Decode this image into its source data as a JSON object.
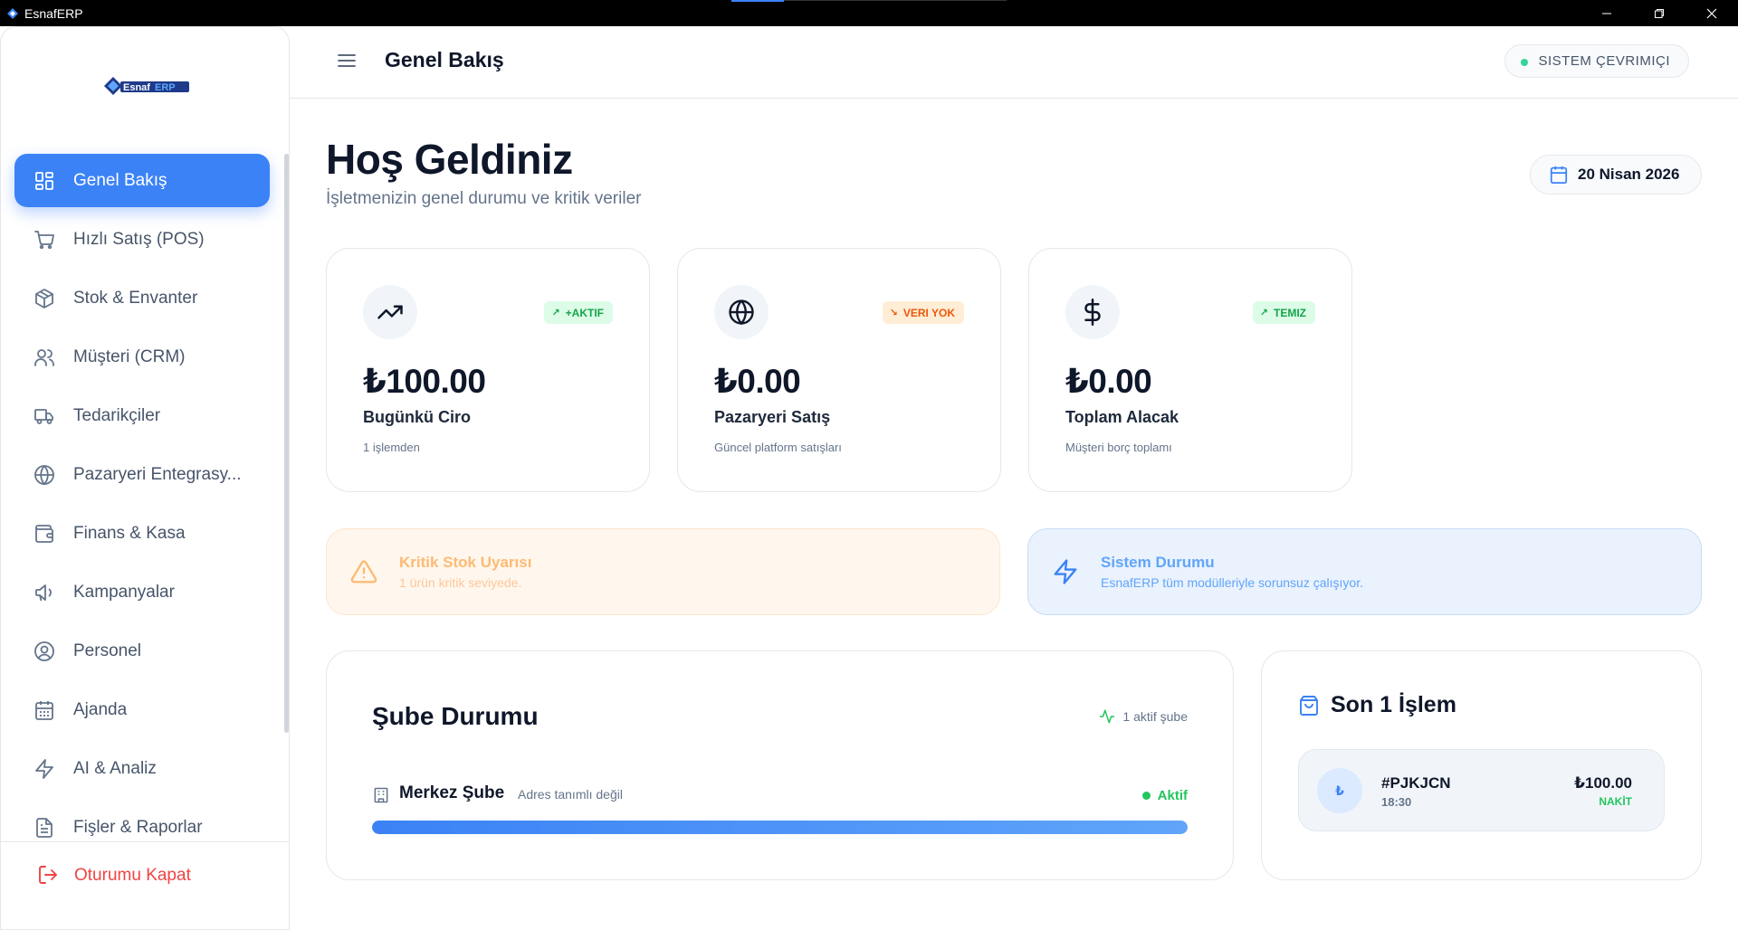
{
  "window": {
    "title": "EsnafERP"
  },
  "sidebar": {
    "brand": {
      "part1": "Esnaf",
      "part2": "ERP"
    },
    "items": [
      {
        "label": "Genel Bakış",
        "icon": "dashboard-icon",
        "active": true
      },
      {
        "label": "Hızlı Satış (POS)",
        "icon": "cart-icon"
      },
      {
        "label": "Stok & Envanter",
        "icon": "box-icon"
      },
      {
        "label": "Müşteri (CRM)",
        "icon": "users-icon"
      },
      {
        "label": "Tedarikçiler",
        "icon": "truck-icon"
      },
      {
        "label": "Pazaryeri Entegrasy...",
        "icon": "globe-icon"
      },
      {
        "label": "Finans & Kasa",
        "icon": "wallet-icon"
      },
      {
        "label": "Kampanyalar",
        "icon": "megaphone-icon"
      },
      {
        "label": "Personel",
        "icon": "user-circle-icon"
      },
      {
        "label": "Ajanda",
        "icon": "calendar-icon"
      },
      {
        "label": "AI & Analiz",
        "icon": "zap-icon"
      },
      {
        "label": "Fişler & Raporlar",
        "icon": "file-icon"
      }
    ],
    "logout_label": "Oturumu Kapat"
  },
  "header": {
    "title": "Genel Bakış",
    "status": "SISTEM ÇEVRIMIÇI"
  },
  "welcome": {
    "title": "Hoş Geldiniz",
    "subtitle": "İşletmenizin genel durumu ve kritik veriler",
    "date": "20 Nisan 2026"
  },
  "stats": [
    {
      "value": "₺100.00",
      "title": "Bugünkü Ciro",
      "desc": "1 işlemden",
      "badge": "+AKTIF",
      "badge_color": "#16a34a",
      "icon": "trending-up-icon"
    },
    {
      "value": "₺0.00",
      "title": "Pazaryeri Satış",
      "desc": "Güncel platform satışları",
      "badge": "VERI YOK",
      "badge_color": "#ea580c",
      "icon": "globe-icon"
    },
    {
      "value": "₺0.00",
      "title": "Toplam Alacak",
      "desc": "Müşteri borç toplamı",
      "badge": "TEMIZ",
      "badge_color": "#16a34a",
      "icon": "dollar-icon"
    }
  ],
  "alerts": {
    "stock": {
      "title": "Kritik Stok Uyarısı",
      "desc": "1 ürün kritik seviyede."
    },
    "system": {
      "title": "Sistem Durumu",
      "desc": "EsnafERP tüm modülleriyle sorunsuz çalışıyor."
    }
  },
  "branches": {
    "title": "Şube Durumu",
    "active_count": "1 aktif şube",
    "items": [
      {
        "name": "Merkez Şube",
        "address": "Adres tanımlı değil",
        "status": "Aktif",
        "progress_percent": 100
      }
    ]
  },
  "transactions": {
    "title": "Son 1 İşlem",
    "items": [
      {
        "avatar": "₺",
        "id": "#PJKJCN",
        "time": "18:30",
        "amount": "₺100.00",
        "method": "NAKİT"
      }
    ]
  },
  "colors": {
    "accent": "#3b82f6",
    "success": "#22c55e",
    "danger": "#ef4444",
    "warning": "#fdba74"
  }
}
